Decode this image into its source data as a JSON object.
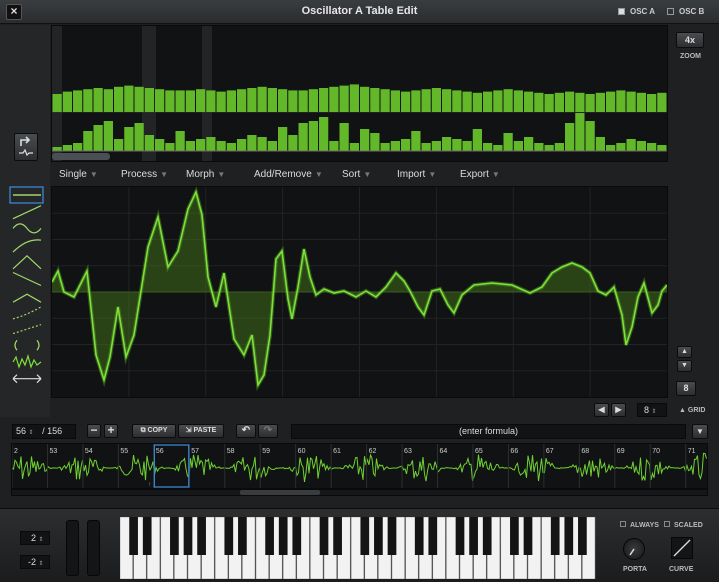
{
  "window": {
    "title": "Oscillator A Table Edit",
    "osc_a": "OSC A",
    "osc_b": "OSC B"
  },
  "zoom": {
    "value": "4x",
    "label": "ZOOM"
  },
  "menu": [
    "Single",
    "Process",
    "Morph",
    "Add/Remove",
    "Sort",
    "Import",
    "Export"
  ],
  "grid": {
    "value": "8",
    "label": "GRID",
    "step": "8"
  },
  "table": {
    "position": "56",
    "total": "/ 156",
    "copy": "COPY",
    "paste": "PASTE",
    "formula": "(enter formula)"
  },
  "frames": {
    "labels": [
      "2",
      "53",
      "54",
      "55",
      "56",
      "57",
      "58",
      "59",
      "60",
      "61",
      "62",
      "63",
      "64",
      "65",
      "66",
      "67",
      "68",
      "69",
      "70",
      "71"
    ],
    "marker": "↑"
  },
  "keyboard": {
    "octave": "2",
    "transpose": "-2",
    "always": "ALWAYS",
    "scaled": "SCALED",
    "porta": "PORTA",
    "curve": "CURVE"
  },
  "colors": {
    "wave": "#7ee03a",
    "fill": "#3e6b1a",
    "bar": "#63b82a"
  }
}
